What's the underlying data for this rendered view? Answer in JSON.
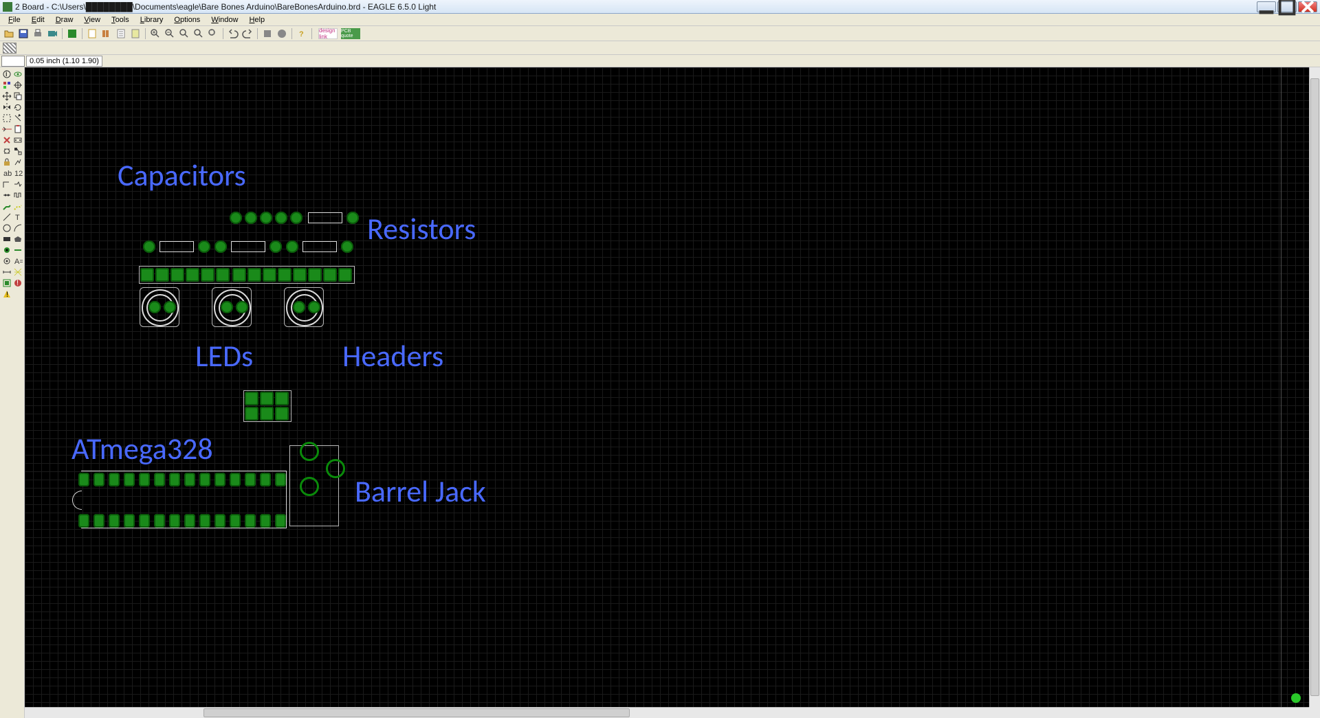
{
  "window": {
    "title": "2 Board - C:\\Users\\████████\\Documents\\eagle\\Bare Bones Arduino\\BareBonesArduino.brd - EAGLE 6.5.0 Light"
  },
  "menu": {
    "file": "File",
    "edit": "Edit",
    "draw": "Draw",
    "view": "View",
    "tools": "Tools",
    "library": "Library",
    "options": "Options",
    "window": "Window",
    "help": "Help"
  },
  "toolbar": {
    "designlink": "design link",
    "pcbquote": "PCB quote"
  },
  "coord": {
    "text": "0.05 inch (1.10 1.90)"
  },
  "annotations": {
    "capacitors": "Capacitors",
    "resistors": "Resistors",
    "leds": "LEDs",
    "headers": "Headers",
    "atmega": "ATmega328",
    "barrel": "Barrel Jack"
  }
}
